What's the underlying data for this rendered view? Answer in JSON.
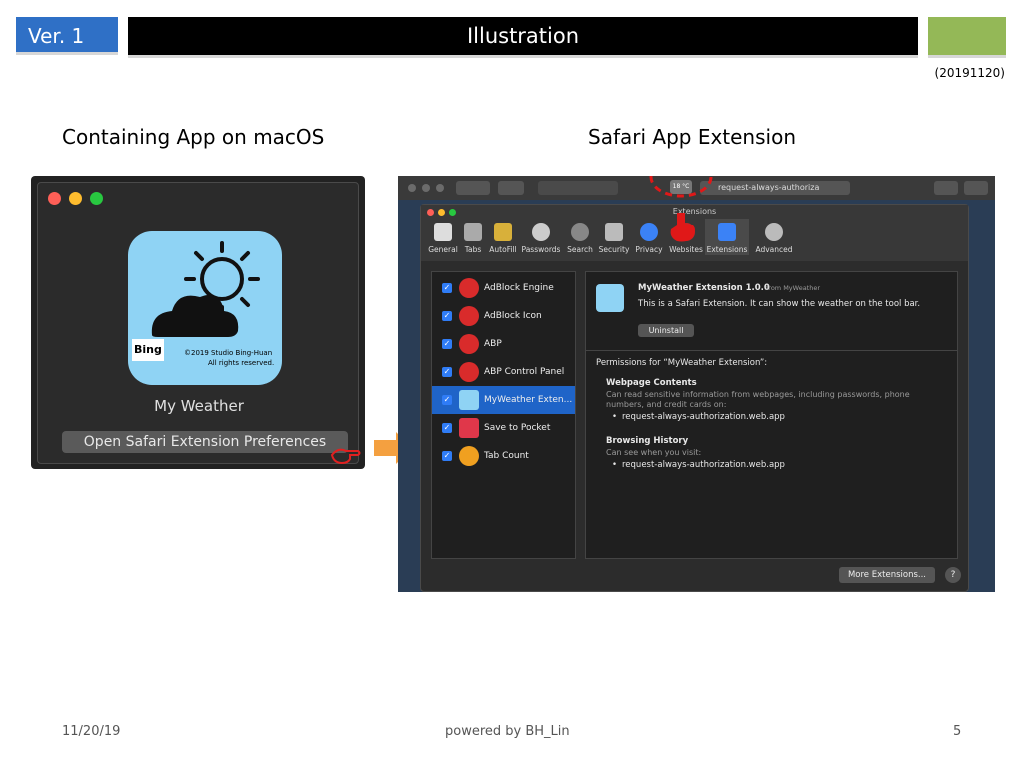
{
  "header": {
    "version": "Ver. 1",
    "title": "Illustration",
    "date": "(20191120)"
  },
  "sections": {
    "left_title": "Containing App on macOS",
    "right_title": "Safari App Extension"
  },
  "app": {
    "name": "My Weather",
    "button_label": "Open Safari Extension Preferences",
    "icon_caption_brand": "Bing",
    "icon_caption_copyright": "©2019 Studio Bing-Huan",
    "icon_caption_rights": "All rights reserved."
  },
  "safari": {
    "address": "request-always-authoriza",
    "temp_badge": "18 °C",
    "window_title": "Extensions",
    "tabs": [
      {
        "label": "General",
        "icon": "switch-icon"
      },
      {
        "label": "Tabs",
        "icon": "tabs-icon"
      },
      {
        "label": "AutoFill",
        "icon": "pencil-icon"
      },
      {
        "label": "Passwords",
        "icon": "key-icon"
      },
      {
        "label": "Search",
        "icon": "magnifier-icon"
      },
      {
        "label": "Security",
        "icon": "lock-icon"
      },
      {
        "label": "Privacy",
        "icon": "hand-icon"
      },
      {
        "label": "Websites",
        "icon": "globe-icon"
      },
      {
        "label": "Extensions",
        "icon": "puzzle-icon"
      },
      {
        "label": "Advanced",
        "icon": "gear-icon"
      }
    ],
    "extensions": [
      {
        "label": "AdBlock Engine",
        "color": "#d92b2b"
      },
      {
        "label": "AdBlock Icon",
        "color": "#d92b2b"
      },
      {
        "label": "ABP",
        "color": "#d92b2b"
      },
      {
        "label": "ABP Control Panel",
        "color": "#d92b2b"
      },
      {
        "label": "MyWeather Exten...",
        "color": "#8fd3f4"
      },
      {
        "label": "Save to Pocket",
        "color": "#e0374a"
      },
      {
        "label": "Tab Count",
        "color": "#f0a020"
      }
    ],
    "detail": {
      "name": "MyWeather Extension 1.0.0",
      "from": "from MyWeather",
      "description": "This is a Safari Extension. It can show the weather on the tool bar.",
      "uninstall": "Uninstall",
      "permissions_header": "Permissions for “MyWeather Extension”:",
      "webpage_title": "Webpage Contents",
      "webpage_desc_1": "Can read sensitive information from webpages, including passwords, phone",
      "webpage_desc_2": "numbers, and credit cards on:",
      "webpage_site": "request-always-authorization.web.app",
      "history_title": "Browsing History",
      "history_desc": "Can see when you visit:",
      "history_site": "request-always-authorization.web.app"
    },
    "more_extensions": "More Extensions...",
    "help": "?"
  },
  "footer": {
    "date": "11/20/19",
    "credit": "powered by BH_Lin",
    "page": "5"
  },
  "colors": {
    "version_blue": "#2f70c6",
    "accent_green": "#94b857",
    "selection_blue": "#1f64c8",
    "arrow_orange": "#f4a040"
  }
}
